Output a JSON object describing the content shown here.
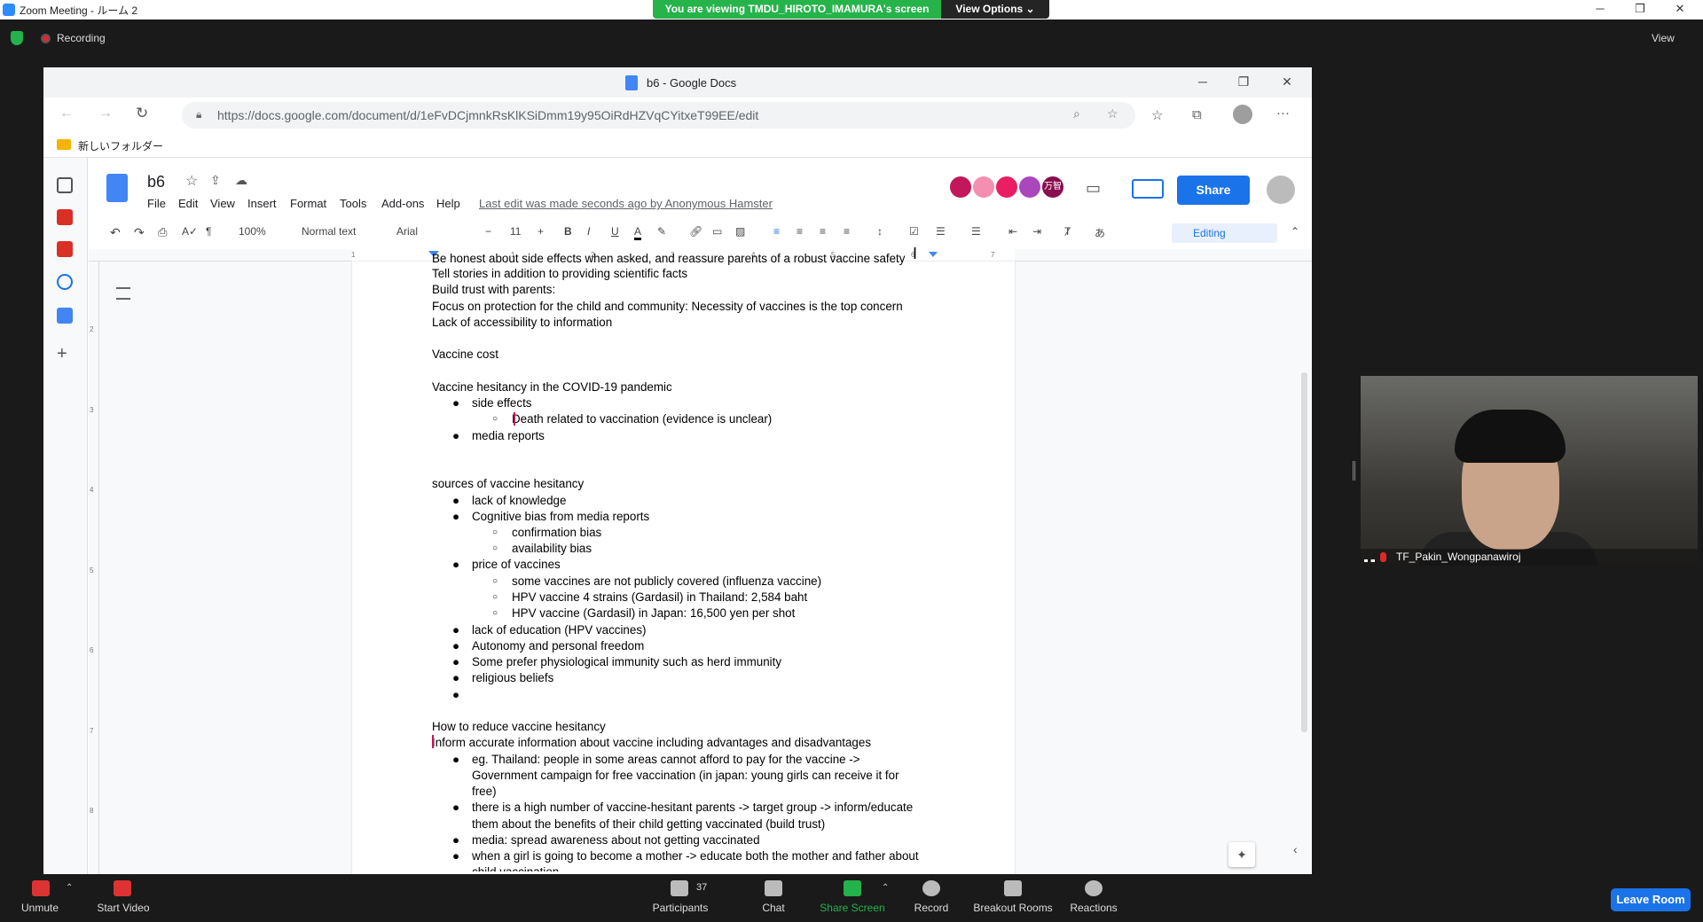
{
  "zoom": {
    "window_title": "Zoom Meeting - ルーム 2",
    "viewing_banner": "You are viewing TMDU_HIROTO_IMAMURA's screen",
    "view_options": "View Options ⌄",
    "recording_label": "Recording",
    "view_label": "View",
    "participant_name": "TF_Pakin_Wongpanawiroj",
    "bottom": {
      "unmute": "Unmute",
      "start_video": "Start Video",
      "participants": "Participants",
      "participants_count": "37",
      "chat": "Chat",
      "share_screen": "Share Screen",
      "record": "Record",
      "breakout": "Breakout Rooms",
      "reactions": "Reactions",
      "leave": "Leave Room"
    }
  },
  "browser": {
    "tab_title": "b6 - Google Docs",
    "url": "https://docs.google.com/document/d/1eFvDCjmnkRsKlKSiDmm19y95OiRdHZVqCYitxeT99EE/edit",
    "bookmark_folder": "新しいフォルダー"
  },
  "docs": {
    "title": "b6",
    "menu": [
      "File",
      "Edit",
      "View",
      "Insert",
      "Format",
      "Tools",
      "Add-ons",
      "Help"
    ],
    "last_edit": "Last edit was made seconds ago by Anonymous Hamster",
    "share": "Share",
    "avatar_label": "万智",
    "toolbar": {
      "zoom": "100%",
      "style": "Normal text",
      "font": "Arial",
      "size": "11",
      "mode": "Editing"
    },
    "ruler": [
      "1",
      "1",
      "2",
      "3",
      "4",
      "5",
      "6",
      "7"
    ],
    "vruler": [
      "2",
      "3",
      "4",
      "5",
      "6",
      "7",
      "8"
    ],
    "lines": {
      "l0": "Be honest about side effects when asked, and reassure parents of a robust vaccine safety",
      "l1": "Tell stories in addition to providing scientific facts",
      "l2": "Build trust with parents:",
      "l3": "Focus on protection for the child and community: Necessity of vaccines is the top concern",
      "l4": "Lack of accessibility to information",
      "l5": "Vaccine cost",
      "l6": "Vaccine hesitancy in the COVID-19 pandemic",
      "l7": "side effects",
      "l8": "Death related to vaccination (evidence is unclear)",
      "l9": "media reports",
      "l10": "sources of vaccine hesitancy",
      "l11": "lack of knowledge",
      "l12": "Cognitive bias from media reports",
      "l13": "confirmation bias",
      "l14": "availability bias",
      "l15": "price of vaccines",
      "l16": "some vaccines are not publicly covered (influenza vaccine)",
      "l17": "HPV vaccine 4 strains (Gardasil) in Thailand: 2,584 baht",
      "l18": "HPV vaccine (Gardasil) in Japan: 16,500 yen per shot",
      "l19": "lack of education (HPV vaccines)",
      "l20": "Autonomy and personal freedom",
      "l21": "Some prefer physiological immunity such as herd immunity",
      "l22": "religious beliefs",
      "l23": "How to reduce vaccine hesitancy",
      "l24": "Inform accurate information about vaccine including advantages and disadvantages",
      "l25": "eg. Thailand: people in some areas cannot afford to pay for the vaccine ->",
      "l26": "Government campaign for free vaccination (in japan: young girls can receive it for",
      "l27": "free)",
      "l28": "there is a high number of vaccine-hesitant parents -> target group -> inform/educate",
      "l29": "them about the benefits of their child getting vaccinated (build trust)",
      "l30": "media: spread awareness about not getting vaccinated",
      "l31": "when a girl is going to become a mother -> educate both the mother and father about",
      "l32": "child vaccination"
    }
  }
}
